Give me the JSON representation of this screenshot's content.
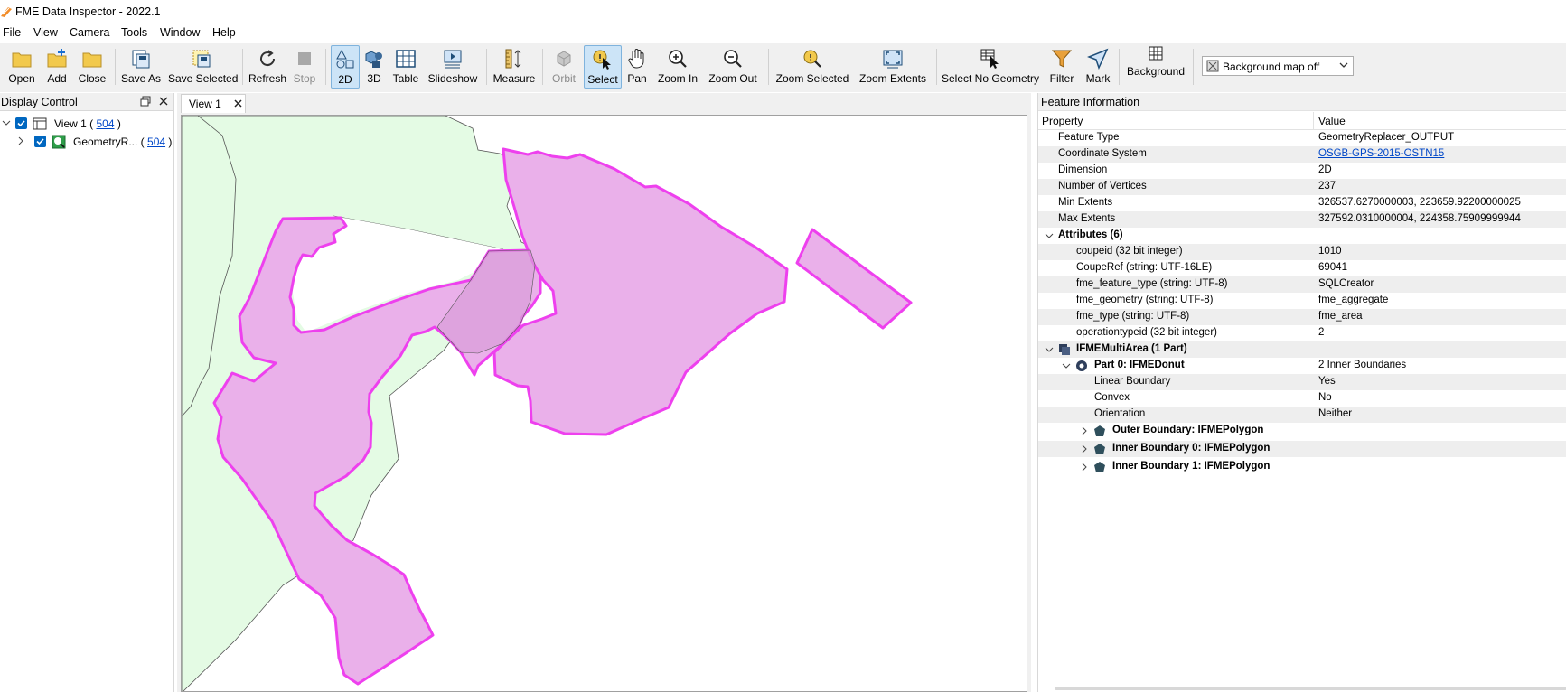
{
  "window": {
    "title": "FME Data Inspector - 2022.1"
  },
  "menu": [
    "File",
    "View",
    "Camera",
    "Tools",
    "Window",
    "Help"
  ],
  "toolbar": {
    "open": "Open",
    "add": "Add",
    "close": "Close",
    "save_as": "Save As",
    "save_selected": "Save Selected",
    "refresh": "Refresh",
    "stop": "Stop",
    "view_2d": "2D",
    "view_3d": "3D",
    "table": "Table",
    "slideshow": "Slideshow",
    "measure": "Measure",
    "orbit": "Orbit",
    "select": "Select",
    "pan": "Pan",
    "zoom_in": "Zoom In",
    "zoom_out": "Zoom Out",
    "zoom_selected": "Zoom Selected",
    "zoom_extents": "Zoom Extents",
    "select_no_geometry": "Select No Geometry",
    "filter": "Filter",
    "mark": "Mark",
    "background": "Background",
    "background_map_value": "Background map off"
  },
  "display_control": {
    "title": "Display Control",
    "view": {
      "label": "View 1 (",
      "count": "504",
      "close_paren": ")"
    },
    "layer": {
      "label": "GeometryR... (",
      "count": "504",
      "close_paren": ")"
    }
  },
  "view_tab": {
    "label": "View 1"
  },
  "feature_info": {
    "title": "Feature Information",
    "col_property": "Property",
    "col_value": "Value",
    "basic": [
      {
        "property": "Feature Type",
        "value": "GeometryReplacer_OUTPUT"
      },
      {
        "property": "Coordinate System",
        "value": "OSGB-GPS-2015-OSTN15"
      },
      {
        "property": "Dimension",
        "value": "2D"
      },
      {
        "property": "Number of Vertices",
        "value": "237"
      },
      {
        "property": "Min Extents",
        "value": "326537.6270000003, 223659.92200000025"
      },
      {
        "property": "Max Extents",
        "value": "327592.0310000004, 224358.75909999944"
      }
    ],
    "attributes_header": "Attributes (6)",
    "attributes": [
      {
        "property": "coupeid (32 bit integer)",
        "value": "1010"
      },
      {
        "property": "CoupeRef (string: UTF-16LE)",
        "value": "69041"
      },
      {
        "property": "fme_feature_type (string: UTF-8)",
        "value": "SQLCreator"
      },
      {
        "property": "fme_geometry (string: UTF-8)",
        "value": "fme_aggregate"
      },
      {
        "property": "fme_type (string: UTF-8)",
        "value": "fme_area"
      },
      {
        "property": "operationtypeid (32 bit integer)",
        "value": "2"
      }
    ],
    "geometry_header": "IFMEMultiArea (1 Part)",
    "part0": {
      "label": "Part 0: IFMEDonut",
      "value": "2 Inner Boundaries"
    },
    "part0_props": [
      {
        "property": "Linear Boundary",
        "value": "Yes"
      },
      {
        "property": "Convex",
        "value": "No"
      },
      {
        "property": "Orientation",
        "value": "Neither"
      }
    ],
    "boundaries": [
      "Outer Boundary: IFMEPolygon",
      "Inner Boundary 0: IFMEPolygon",
      "Inner Boundary 1: IFMEPolygon"
    ]
  },
  "colors": {
    "selected_fill": "#eab0ea",
    "selected_stroke": "#ee40ee",
    "context_fill": "#e4fbe4",
    "active_button": "#cce4f7",
    "link": "#0047c8"
  }
}
